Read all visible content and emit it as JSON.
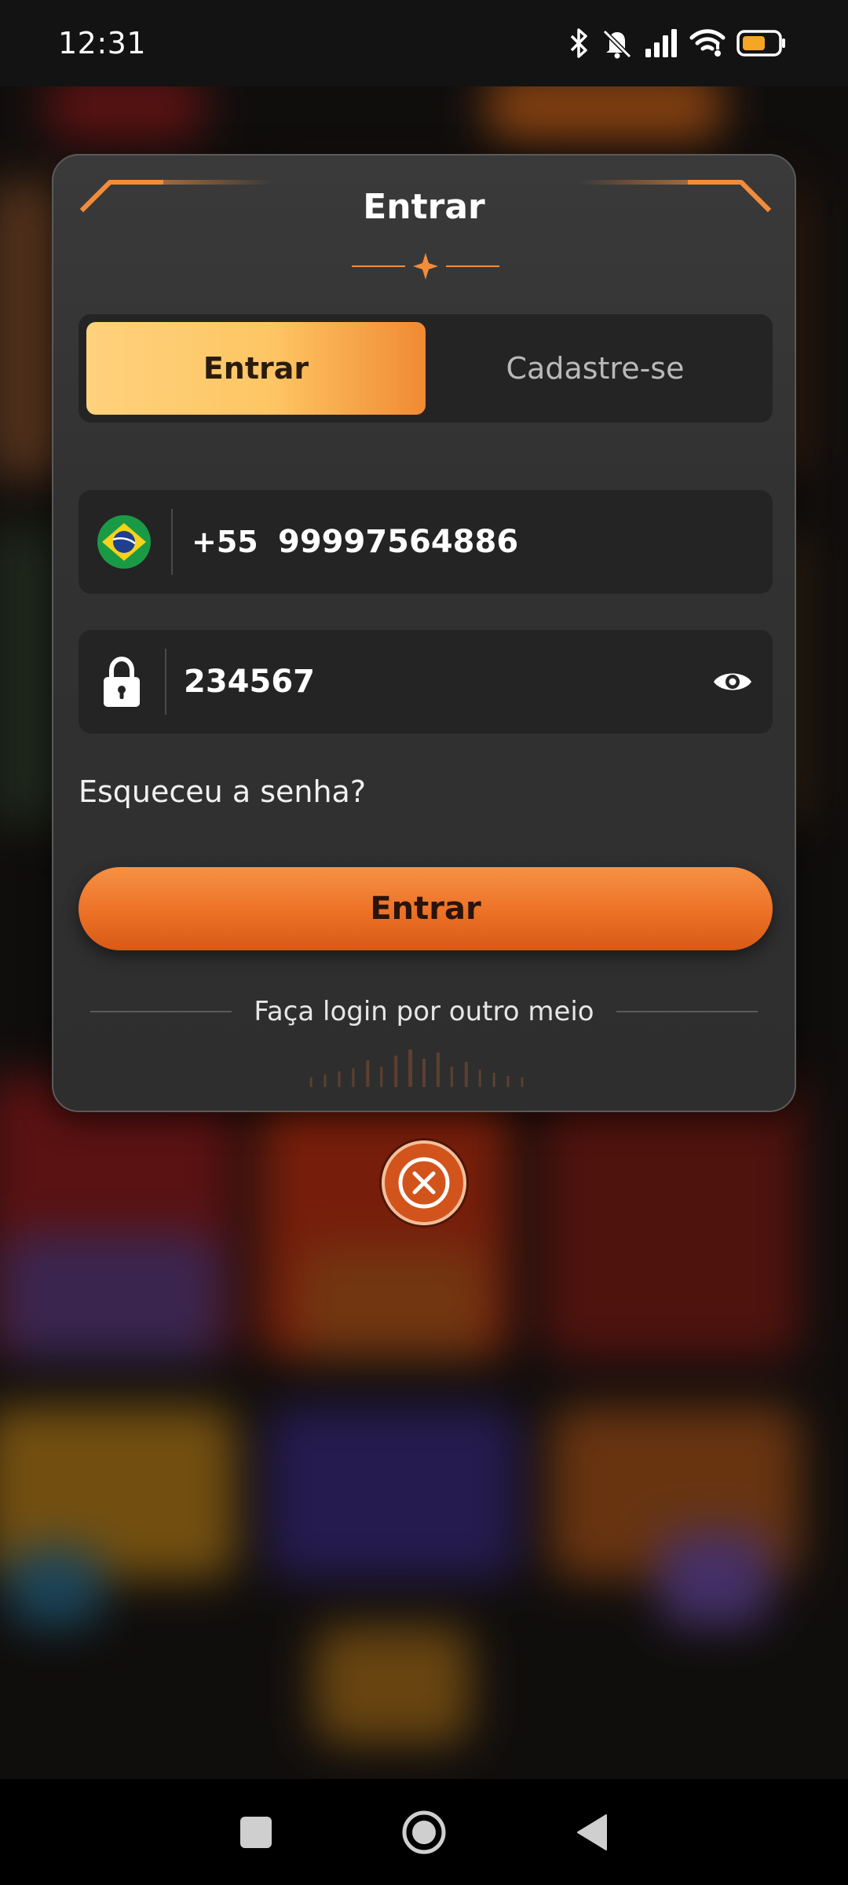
{
  "status_bar": {
    "time": "12:31",
    "icons": [
      "bluetooth-icon",
      "bell-off-icon",
      "signal-icon",
      "wifi-icon",
      "battery-icon"
    ],
    "battery_color": "#f5a623"
  },
  "login_modal": {
    "title": "Entrar",
    "tabs": [
      {
        "label": "Entrar",
        "active": true
      },
      {
        "label": "Cadastre-se",
        "active": false
      }
    ],
    "phone": {
      "flag_icon": "brazil-flag-icon",
      "dial_code": "+55",
      "value": "99997564886"
    },
    "password": {
      "value": "234567",
      "lock_icon": "lock-icon",
      "toggle_icon": "eye-icon"
    },
    "forgot_password": "Esqueceu a senha?",
    "submit_label": "Entrar",
    "other_login_label": "Faça login por outro meio"
  },
  "close_button": {
    "icon": "close-icon"
  },
  "colors": {
    "accent": "#ec7126",
    "tab_active_start": "#ffd27c",
    "tab_active_end": "#f08a33",
    "modal_bg": "#333333",
    "field_bg": "#242424"
  }
}
